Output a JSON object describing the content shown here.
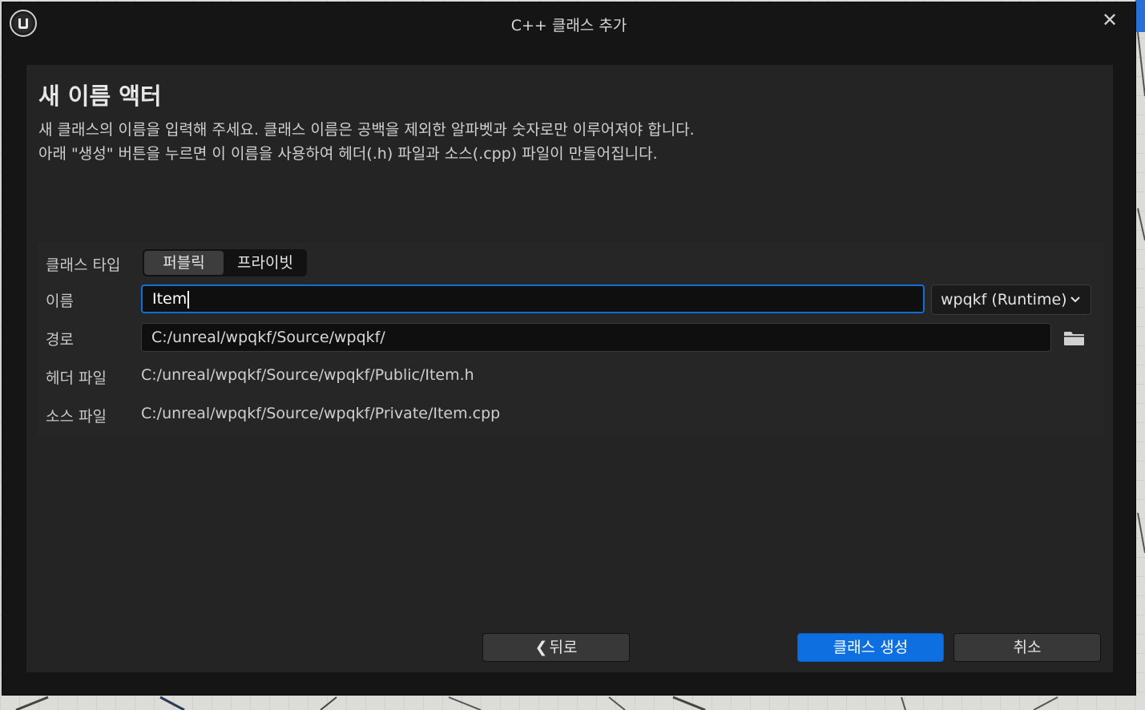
{
  "window": {
    "title": "C++ 클래스 추가",
    "close_label": "✕",
    "logo_icon": "unreal-engine-logo"
  },
  "panel": {
    "heading": "새 이름 액터",
    "description_line1": "새 클래스의 이름을 입력해 주세요. 클래스 이름은 공백을 제외한 알파벳과 숫자로만 이루어져야 합니다.",
    "description_line2": "아래 \"생성\" 버튼을 누르면 이 이름을 사용하여 헤더(.h) 파일과 소스(.cpp) 파일이 만들어집니다."
  },
  "form": {
    "class_type_label": "클래스 타입",
    "class_type_options": [
      "퍼블릭",
      "프라이빗"
    ],
    "class_type_selected": "퍼블릭",
    "name_label": "이름",
    "name_value": "Item",
    "module_value": "wpqkf (Runtime)",
    "path_label": "경로",
    "path_value": "C:/unreal/wpqkf/Source/wpqkf/",
    "header_file_label": "헤더 파일",
    "header_file_value": "C:/unreal/wpqkf/Source/wpqkf/Public/Item.h",
    "source_file_label": "소스 파일",
    "source_file_value": "C:/unreal/wpqkf/Source/wpqkf/Private/Item.cpp"
  },
  "buttons": {
    "back_label": "뒤로",
    "create_label": "클래스 생성",
    "cancel_label": "취소"
  },
  "colors": {
    "accent": "#0e6fe0",
    "window_bg": "#151515",
    "panel_bg": "#242424"
  }
}
